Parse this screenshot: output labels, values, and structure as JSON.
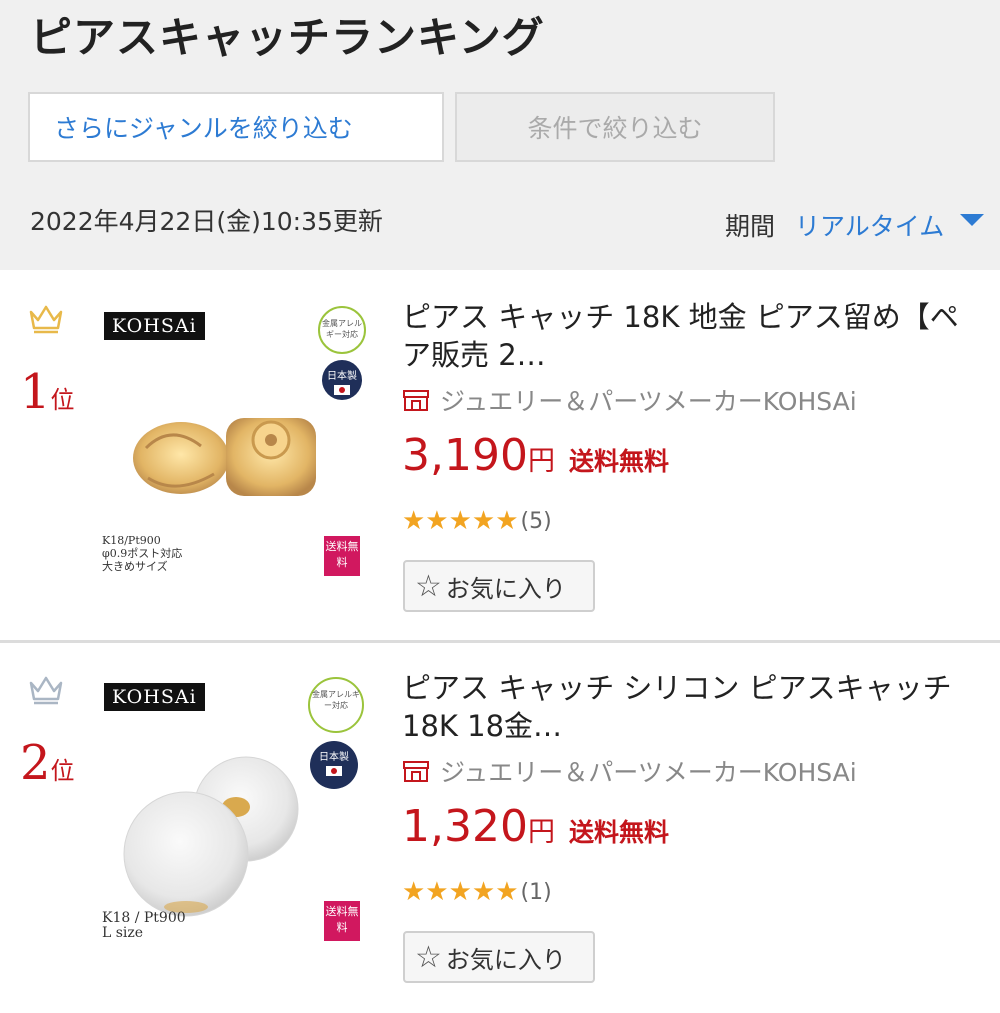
{
  "header": {
    "title": "ピアスキャッチランキング",
    "genre_button": "さらにジャンルを絞り込む",
    "condition_button": "条件で絞り込む",
    "updated": "2022年4月22日(金)10:35更新",
    "period_label": "期間",
    "period_value": "リアルタイム"
  },
  "colors": {
    "accent": "#2d7bd3",
    "price": "#c4161c",
    "star": "#f2a421",
    "gold": "#e8b94a",
    "silver": "#aab6c4"
  },
  "items": [
    {
      "rank_num": "1",
      "rank_suffix": "位",
      "crown_icon": "gold-crown-icon",
      "logo": "KOHSAi",
      "allergy_badge": "金属アレルギー対応",
      "japan_badge": "日本製",
      "shipping_badge": "送料無料",
      "spec_line1": "K18/Pt900",
      "spec_line2": "φ0.9ポスト対応",
      "spec_line3": "大きめサイズ",
      "title": "ピアス キャッチ 18K 地金 ピアス留め【ペア販売 2…",
      "shop": "ジュエリー＆パーツメーカーKOHSAi",
      "price": "3,190",
      "currency": "円",
      "shipping": "送料無料",
      "stars": 5,
      "review_count": "(5)",
      "favorite_label": "お気に入り"
    },
    {
      "rank_num": "2",
      "rank_suffix": "位",
      "crown_icon": "silver-crown-icon",
      "logo": "KOHSAi",
      "allergy_badge": "金属アレルギー対応",
      "japan_badge": "日本製",
      "shipping_badge": "送料無料",
      "spec_line1": "K18 / Pt900",
      "spec_line2": "L size",
      "title": "ピアス キャッチ シリコン ピアスキャッチ 18K 18金…",
      "shop": "ジュエリー＆パーツメーカーKOHSAi",
      "price": "1,320",
      "currency": "円",
      "shipping": "送料無料",
      "stars": 5,
      "review_count": "(1)",
      "favorite_label": "お気に入り"
    }
  ]
}
